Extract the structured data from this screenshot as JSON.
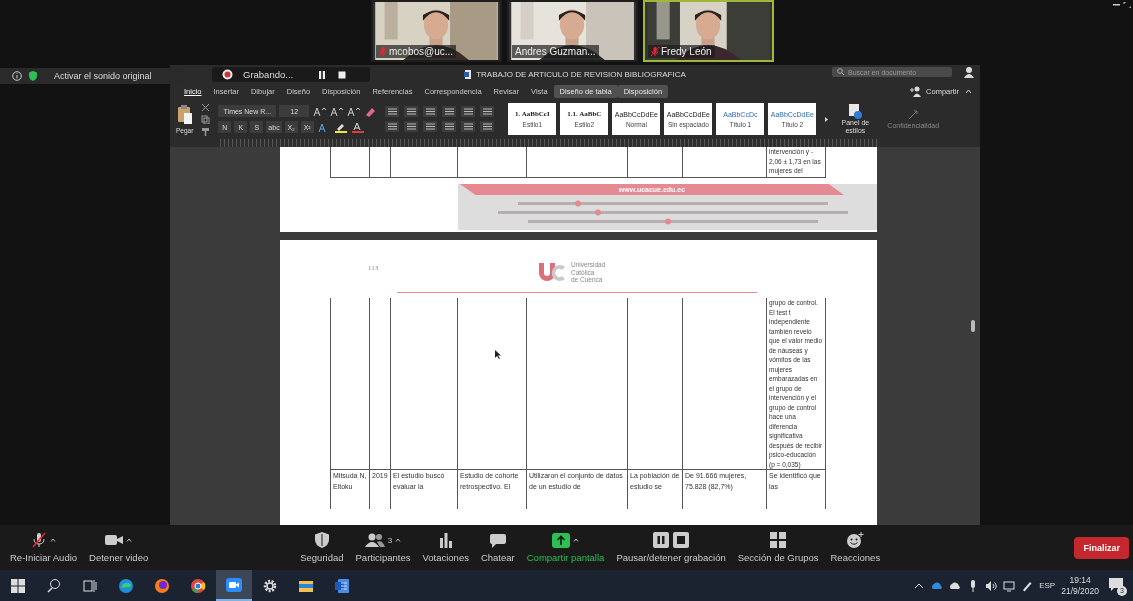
{
  "meeting": {
    "videos": [
      {
        "name": "mcobos@uc...",
        "muted": true,
        "active": false
      },
      {
        "name": "Andres Guzman...",
        "muted": false,
        "active": false
      },
      {
        "name": "Fredy León",
        "muted": true,
        "active": true
      }
    ],
    "audio_banner": {
      "label": "Activar el sonido original"
    },
    "recording": {
      "label": "Grabando..."
    }
  },
  "word": {
    "title": "TRABAJO DE ARTICULO DE REVISION BIBLIOGRAFICA",
    "search": {
      "placeholder": "Buscar en documento"
    },
    "tabs": [
      {
        "label": "Inicio",
        "selected": true,
        "contextual": false
      },
      {
        "label": "Insertar",
        "selected": false,
        "contextual": false
      },
      {
        "label": "Dibujar",
        "selected": false,
        "contextual": false
      },
      {
        "label": "Diseño",
        "selected": false,
        "contextual": false
      },
      {
        "label": "Disposición",
        "selected": false,
        "contextual": false
      },
      {
        "label": "Referencias",
        "selected": false,
        "contextual": false
      },
      {
        "label": "Correspondencia",
        "selected": false,
        "contextual": false
      },
      {
        "label": "Revisar",
        "selected": false,
        "contextual": false
      },
      {
        "label": "Vista",
        "selected": false,
        "contextual": false
      },
      {
        "label": "Diseño de tabla",
        "selected": false,
        "contextual": true
      },
      {
        "label": "Disposición",
        "selected": false,
        "contextual": true
      }
    ],
    "share": "Compartir",
    "paste": "Pegar",
    "font": "Times New R...",
    "size": "12",
    "format_buttons": [
      "N",
      "K",
      "S",
      "abc",
      "X₂",
      "X²"
    ],
    "styles": [
      {
        "preview": "1. AaBbCcI",
        "name": "Estilo1"
      },
      {
        "preview": "1.1. AaBbC",
        "name": "Estilo2"
      },
      {
        "preview": "AaBbCcDdEe",
        "name": "Normal"
      },
      {
        "preview": "AaBbCcDdEe",
        "name": "Sin espaciado"
      },
      {
        "preview": "AaBbCcDc",
        "name": "Título 1"
      },
      {
        "preview": "AaBbCcDdEe",
        "name": "Título 2"
      }
    ],
    "styles_pane": "Panel de estilos",
    "sensitivity": "Confidencialidad"
  },
  "document": {
    "page1": {
      "last_cell": "intervención y - 2,06 ± 1,73 en las mujeres del",
      "website": "www.ucacue.edu.ec"
    },
    "page2": {
      "page_number": "113",
      "logo_lines": [
        "Universidad",
        "Católica",
        "de Cuenca"
      ],
      "continued_cell": "grupo de control. El test t independiente también reveló que el valor medio de náuseas y vómitos de las mujeres embarazadas en el grupo de intervención y el grupo de control hace una diferencia significativa después de recibir psico-educación (p = 0,035)",
      "row": [
        "Mitsuda N, Eitoku",
        "2019",
        "El estudio buscó evaluar la",
        "Estudio de cohorte retrospectivo. El",
        "Utilizaron el conjunto de datos de un estudio de",
        "La población de estudio se",
        "De 91.666 mujeres, 75.828 (82,7%)",
        "Se identificó que las"
      ]
    }
  },
  "toolbar": {
    "controls": [
      {
        "kind": "audio",
        "label": "Re-Iniciar Audio",
        "muted": true
      },
      {
        "kind": "video",
        "label": "Detener video"
      },
      {
        "kind": "security",
        "label": "Seguridad"
      },
      {
        "kind": "participants",
        "label": "Participantes",
        "count": "3"
      },
      {
        "kind": "polls",
        "label": "Votaciones"
      },
      {
        "kind": "chat",
        "label": "Chatear"
      },
      {
        "kind": "share",
        "label": "Compartir pantalla"
      },
      {
        "kind": "record",
        "label": "Pausar/detener grabación"
      },
      {
        "kind": "breakout",
        "label": "Sección de Grupos"
      },
      {
        "kind": "reactions",
        "label": "Reacciones"
      }
    ],
    "end_button": "Finalizar"
  },
  "taskbar": {
    "apps": [
      {
        "kind": "search",
        "active": false
      },
      {
        "kind": "taskview",
        "active": false
      },
      {
        "kind": "edge",
        "active": false
      },
      {
        "kind": "firefox",
        "active": false
      },
      {
        "kind": "chrome",
        "active": false
      },
      {
        "kind": "zoom",
        "active": true
      },
      {
        "kind": "settings",
        "active": false
      },
      {
        "kind": "explorer",
        "active": false
      },
      {
        "kind": "word",
        "active": false
      }
    ],
    "language": "ESP",
    "time": "19:14",
    "date": "21/9/2020",
    "notifications": "3"
  }
}
